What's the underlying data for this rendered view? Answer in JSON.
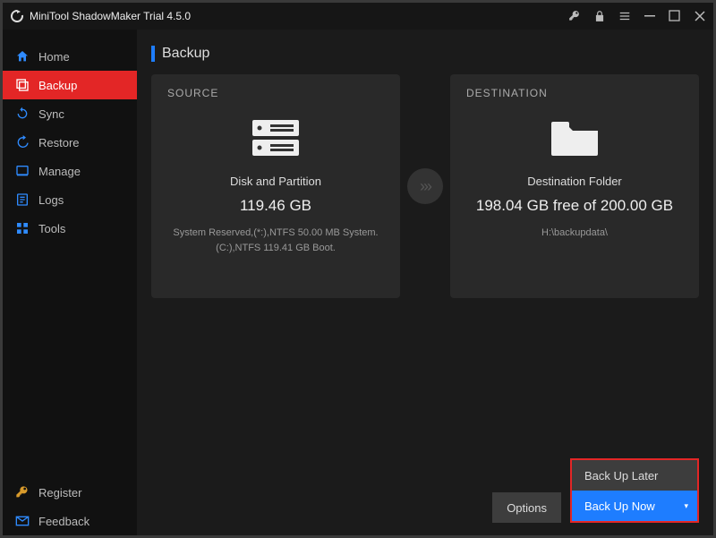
{
  "app": {
    "title": "MiniTool ShadowMaker Trial 4.5.0"
  },
  "sidebar": {
    "items": [
      {
        "label": "Home"
      },
      {
        "label": "Backup"
      },
      {
        "label": "Sync"
      },
      {
        "label": "Restore"
      },
      {
        "label": "Manage"
      },
      {
        "label": "Logs"
      },
      {
        "label": "Tools"
      }
    ],
    "bottom": [
      {
        "label": "Register"
      },
      {
        "label": "Feedback"
      }
    ]
  },
  "page": {
    "heading": "Backup"
  },
  "source": {
    "title": "SOURCE",
    "line1": "Disk and Partition",
    "size": "119.46 GB",
    "details": "System Reserved,(*:),NTFS 50.00 MB System. (C:),NTFS 119.41 GB Boot."
  },
  "destination": {
    "title": "DESTINATION",
    "line1": "Destination Folder",
    "size": "198.04 GB free of 200.00 GB",
    "path": "H:\\backupdata\\"
  },
  "buttons": {
    "options": "Options",
    "later": "Back Up Later",
    "now": "Back Up Now"
  }
}
